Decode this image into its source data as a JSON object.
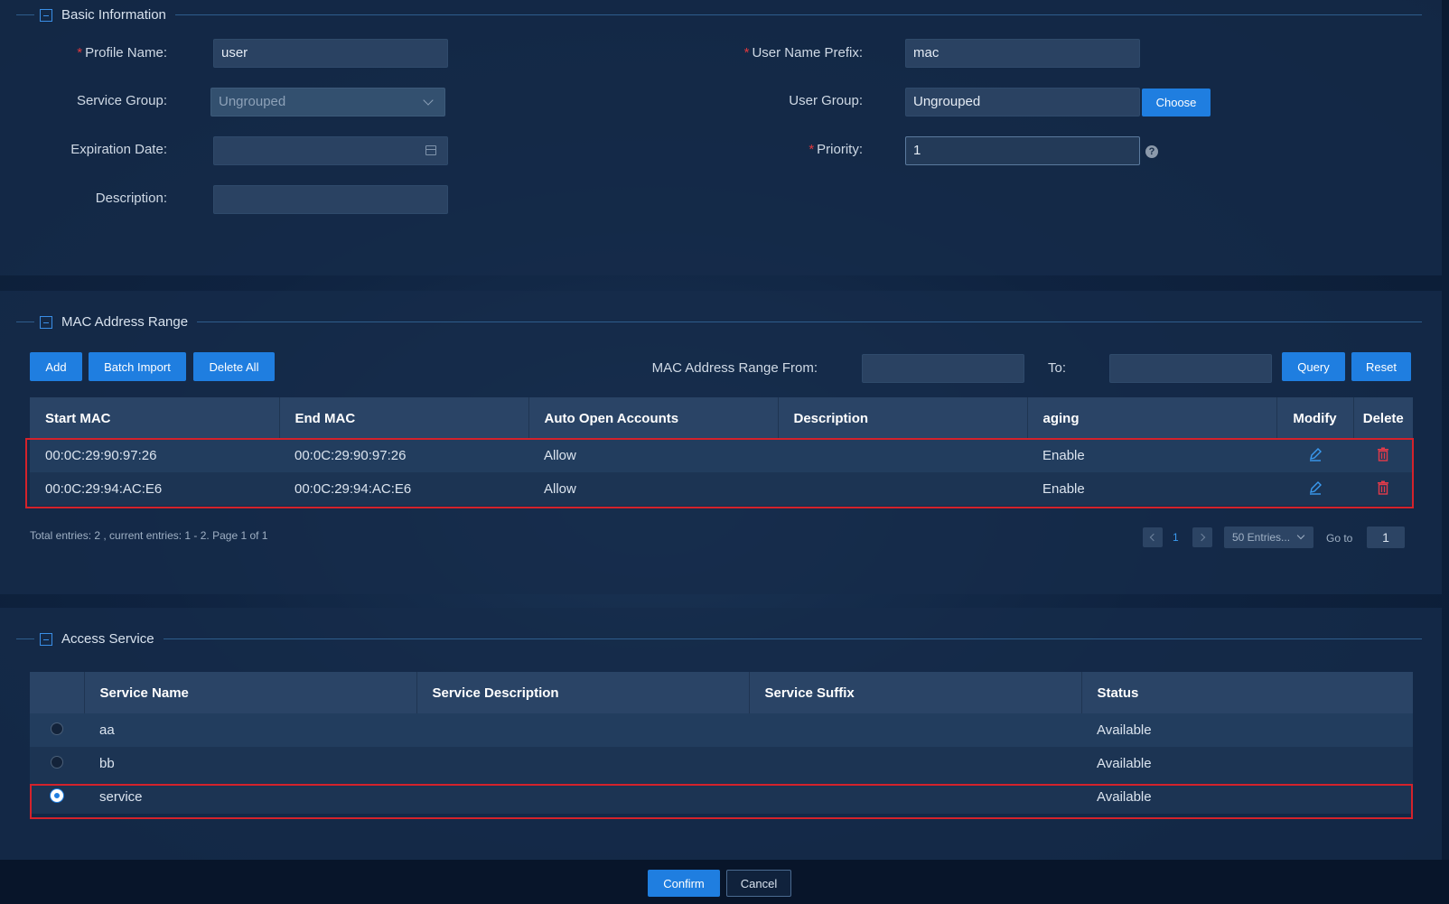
{
  "basic": {
    "section_title": "Basic Information",
    "profile_name_label": "Profile Name",
    "profile_name_value": "user",
    "user_name_prefix_label": "User Name Prefix",
    "user_name_prefix_value": "mac",
    "service_group_label": "Service Group",
    "service_group_value": "Ungrouped",
    "user_group_label": "User Group",
    "user_group_value": "Ungrouped",
    "choose_label": "Choose",
    "expiration_label": "Expiration Date",
    "priority_label": "Priority",
    "priority_value": "1",
    "description_label": "Description",
    "colon": ":",
    "required_mark": "*",
    "help_icon": "?"
  },
  "mac": {
    "section_title": "MAC Address Range",
    "add_label": "Add",
    "batch_import_label": "Batch Import",
    "delete_all_label": "Delete All",
    "range_from_label": "MAC Address Range From",
    "to_label": "To",
    "query_label": "Query",
    "reset_label": "Reset",
    "columns": [
      "Start MAC",
      "End MAC",
      "Auto Open Accounts",
      "Description",
      "aging",
      "Modify",
      "Delete"
    ],
    "rows": [
      {
        "start": "00:0C:29:90:97:26",
        "end": "00:0C:29:90:97:26",
        "auto_open": "Allow",
        "description": "",
        "aging": "Enable"
      },
      {
        "start": "00:0C:29:94:AC:E6",
        "end": "00:0C:29:94:AC:E6",
        "auto_open": "Allow",
        "description": "",
        "aging": "Enable"
      }
    ],
    "summary": "Total entries: 2 , current entries: 1 - 2. Page 1 of 1",
    "page": "1",
    "page_size": "50 Entries...",
    "goto_label": "Go to",
    "goto_value": "1"
  },
  "access": {
    "section_title": "Access Service",
    "columns": [
      "",
      "Service Name",
      "Service Description",
      "Service Suffix",
      "Status"
    ],
    "rows": [
      {
        "name": "aa",
        "description": "",
        "suffix": "",
        "status": "Available",
        "selected": false
      },
      {
        "name": "bb",
        "description": "",
        "suffix": "",
        "status": "Available",
        "selected": false
      },
      {
        "name": "service",
        "description": "",
        "suffix": "",
        "status": "Available",
        "selected": true
      }
    ]
  },
  "footer": {
    "confirm_label": "Confirm",
    "cancel_label": "Cancel"
  },
  "colors": {
    "accent": "#1f7ee0",
    "highlight": "#d4222b",
    "delete": "#e23b4a"
  }
}
